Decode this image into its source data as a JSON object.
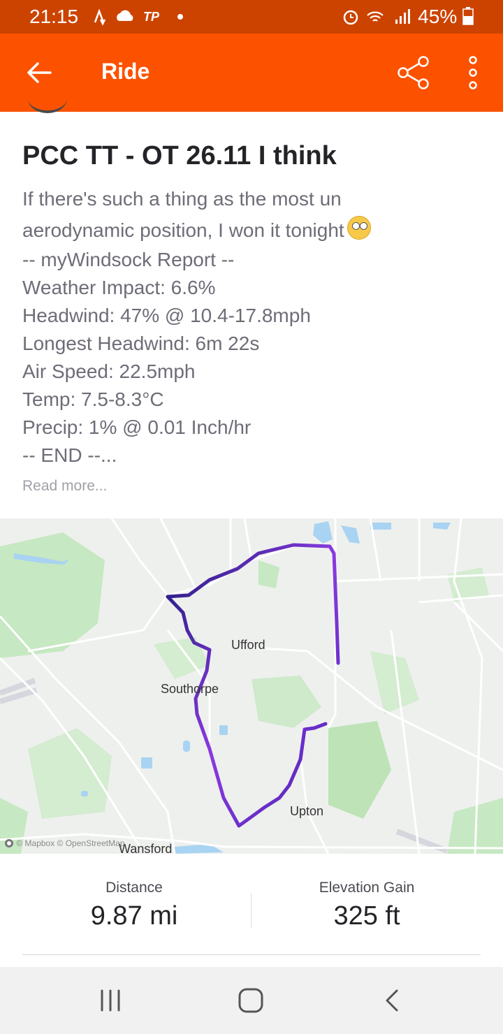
{
  "status_bar": {
    "time": "21:15",
    "carrier_badge": "TP",
    "battery": "45%",
    "icons": [
      "strava-notification-icon",
      "cloud-icon",
      "dot-icon",
      "alarm-icon",
      "wifi-icon",
      "signal-icon",
      "battery-icon"
    ]
  },
  "app_bar": {
    "title": "Ride",
    "icons": [
      "back-arrow-icon",
      "share-icon",
      "more-vertical-icon"
    ]
  },
  "activity": {
    "title": "PCC TT - OT 26.11 I think",
    "description_lines": [
      "If there's such a thing as the most un",
      "aerodynamic position, I won it tonight",
      "-- myWindsock Report --",
      "Weather Impact: 6.6%",
      "Headwind: 47% @ 10.4-17.8mph",
      "Longest Headwind: 6m 22s",
      "Air Speed: 22.5mph",
      "Temp: 7.5-8.3°C",
      "Precip: 1% @ 0.01 Inch/hr",
      "-- END --..."
    ],
    "read_more": "Read more..."
  },
  "map": {
    "labels": {
      "ufford": "Ufford",
      "southorpe": "Southorpe",
      "upton": "Upton",
      "wansford": "Wansford"
    },
    "attribution": "© Mapbox © OpenStreetMap",
    "colors": {
      "route_dark": "#1e1a7a",
      "route_mid": "#6a2ad0",
      "route_light": "#b07af0",
      "park": "#c4e6c0",
      "water": "#a8d4f0"
    }
  },
  "stats": {
    "distance_label": "Distance",
    "distance_value": "9.87 mi",
    "elevation_label": "Elevation Gain",
    "elevation_value": "325 ft"
  },
  "colors": {
    "brand": "#fc5200",
    "status_bar": "#cc4300"
  },
  "nav_bar": {
    "icons": [
      "recents-icon",
      "home-icon",
      "back-icon"
    ]
  }
}
